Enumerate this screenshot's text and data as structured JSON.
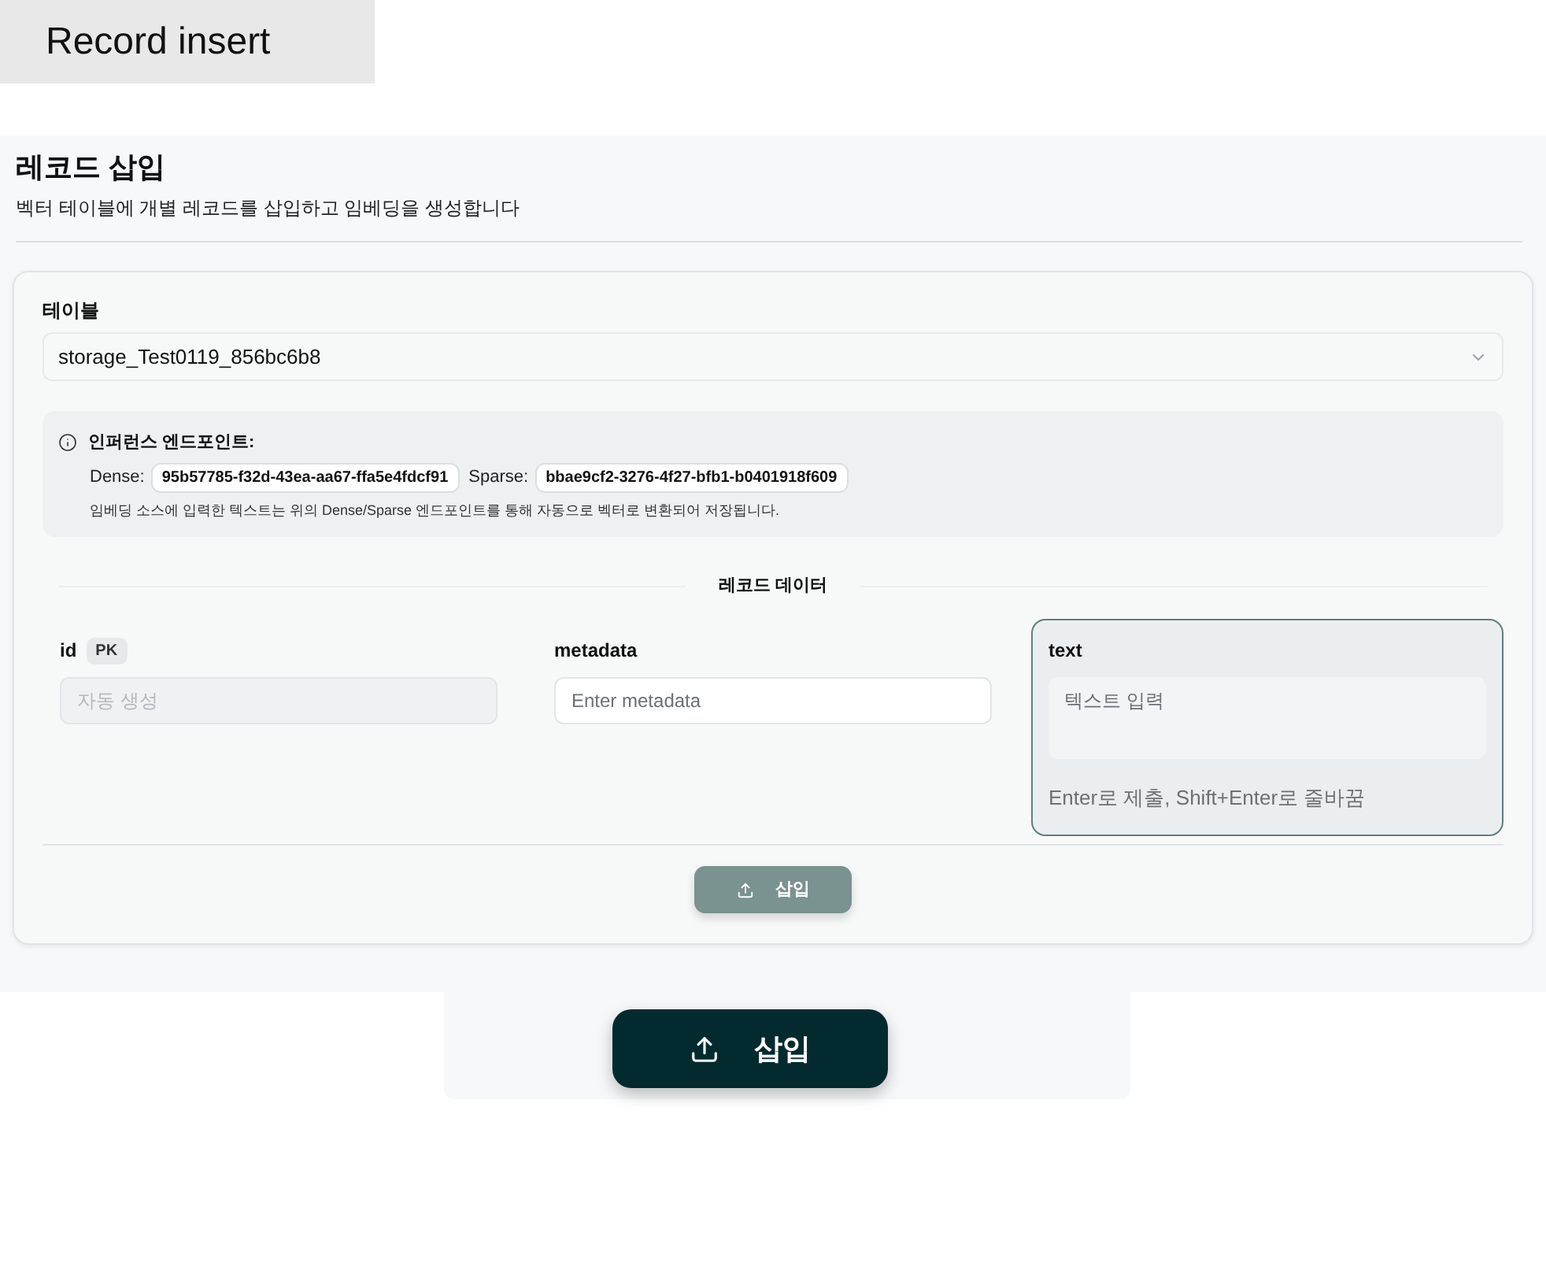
{
  "caption": "Record insert",
  "page": {
    "title": "레코드 삽입",
    "subtitle": "벡터 테이블에 개별 레코드를 삽입하고 임베딩을 생성합니다"
  },
  "form": {
    "table": {
      "label": "테이블",
      "value": "storage_Test0119_856bc6b8"
    },
    "inference": {
      "title": "인퍼런스 엔드포인트:",
      "endpoints": [
        {
          "label": "Dense:",
          "id": "95b57785-f32d-43ea-aa67-ffa5e4fdcf91"
        },
        {
          "label": "Sparse:",
          "id": "bbae9cf2-3276-4f27-bfb1-b0401918f609"
        }
      ],
      "note": "임베딩 소스에 입력한 텍스트는 위의 Dense/Sparse 엔드포인트를 통해 자동으로 벡터로 변환되어 저장됩니다."
    },
    "section_title": "레코드 데이터",
    "fields": [
      {
        "kind": "input",
        "name": "id",
        "badge": "PK",
        "placeholder": "자동 생성",
        "disabled": true,
        "focused": false
      },
      {
        "kind": "input",
        "name": "metadata",
        "placeholder": "Enter metadata",
        "disabled": false,
        "focused": false
      },
      {
        "kind": "textarea",
        "name": "text",
        "placeholder": "텍스트 입력",
        "hint": "Enter로 제출, Shift+Enter로 줄바꿈",
        "disabled": false,
        "focused": true
      }
    ],
    "submit": {
      "label": "삽입",
      "disabled": true
    }
  },
  "preview": {
    "button": {
      "label": "삽입",
      "disabled": false
    }
  }
}
